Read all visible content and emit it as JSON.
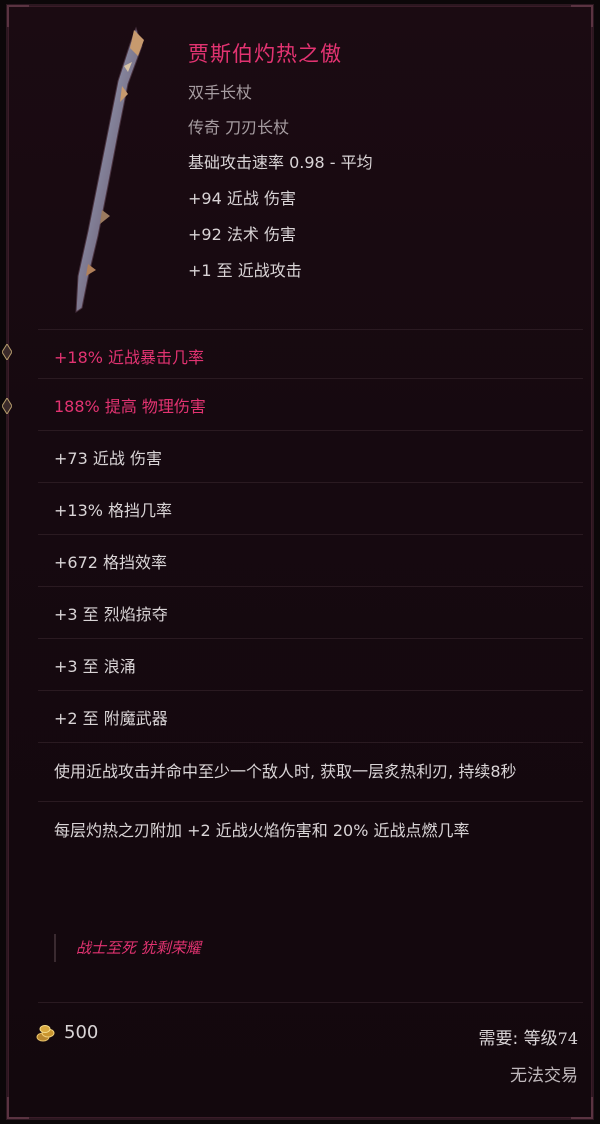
{
  "item": {
    "name": "贾斯伯灼热之傲",
    "type": "双手长杖",
    "rarity": "传奇 刀刃长杖",
    "base_stats": [
      "基础攻击速率 0.98 - 平均",
      "+94 近战 伤害",
      "+92 法术 伤害",
      "+1 至 近战攻击"
    ]
  },
  "affixes": [
    {
      "text": "+18% 近战暴击几率",
      "color": "red"
    },
    {
      "text": "188% 提高 物理伤害",
      "color": "red"
    },
    {
      "text": "+73 近战 伤害",
      "color": "white"
    },
    {
      "text": "+13% 格挡几率",
      "color": "white"
    },
    {
      "text": "+672 格挡效率",
      "color": "white"
    },
    {
      "text": "+3 至 烈焰掠夺",
      "color": "white"
    },
    {
      "text": "+3 至 浪涌",
      "color": "white"
    },
    {
      "text": "+2 至 附魔武器",
      "color": "white"
    },
    {
      "text": "使用近战攻击并命中至少一个敌人时, 获取一层炙热利刃, 持续8秒",
      "color": "white"
    },
    {
      "text": "每层灼热之刃附加 +2 近战火焰伤害和 20% 近战点燃几率",
      "color": "white"
    }
  ],
  "flavor_text": "战士至死 犹剩荣耀",
  "footer": {
    "gold_icon": "gold-coins-icon",
    "gold_value": "500",
    "requirement_label": "需要: 等级",
    "requirement_level": "74",
    "trade_status": "无法交易"
  },
  "colors": {
    "legendary": "#e23371",
    "text": "#d9d4d6",
    "muted": "#a69ca1",
    "background": "#160910"
  }
}
